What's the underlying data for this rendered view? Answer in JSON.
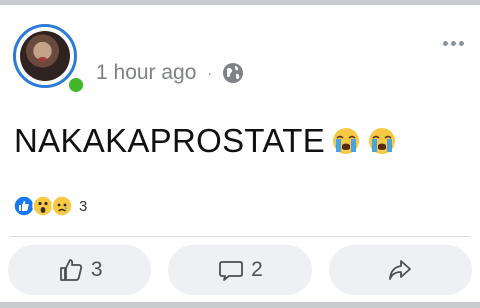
{
  "post": {
    "time": "1 hour ago",
    "separator": "·",
    "privacy_icon": "globe-icon",
    "text": "NAKAKAPROSTATE",
    "emojis": [
      "crying-face-emoji",
      "crying-face-emoji"
    ]
  },
  "reactions": {
    "types": [
      "like",
      "wow",
      "sad"
    ],
    "count": "3"
  },
  "actions": {
    "like_count": "3",
    "comment_count": "2",
    "share_label": ""
  },
  "colors": {
    "accent": "#2d7bd6",
    "online": "#42b72a",
    "like_blue": "#1877f2",
    "reaction_yellow": "#f7c944",
    "meta_gray": "#7e8185"
  }
}
